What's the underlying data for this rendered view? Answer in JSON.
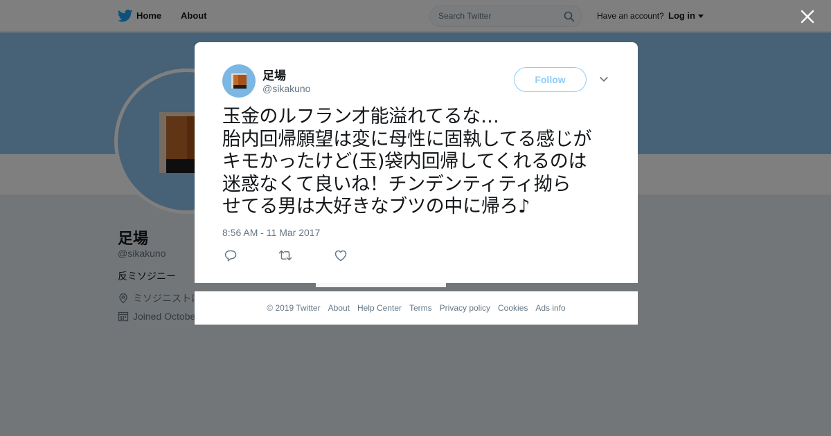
{
  "nav": {
    "home_label": "Home",
    "about_label": "About",
    "search_placeholder": "Search Twitter",
    "account_prompt": "Have an account?",
    "login_label": "Log in",
    "logo_icon": "twitter-bird-icon",
    "search_icon": "magnifier-icon",
    "caret_icon": "caret-down-icon"
  },
  "profile": {
    "name": "足場",
    "handle": "@sikakuno",
    "bio": "反ミソジニー",
    "location": "ミソジニストに",
    "joined": "Joined October",
    "location_icon": "location-pin-icon",
    "calendar_icon": "calendar-icon",
    "banner_color": "#8ec3ec"
  },
  "tweet": {
    "author_name": "足場",
    "author_handle": "@sikakuno",
    "follow_label": "Follow",
    "text_lines": [
      "玉金のルフラン才能溢れてるな…",
      "胎内回帰願望は変に母性に固執してる感じが",
      "キモかったけど(玉)袋内回帰してくれるのは",
      "迷惑なくて良いね！チンデンティティ拗ら",
      "せてる男は大好きなブツの中に帰ろ♪"
    ],
    "timestamp": "8:56 AM - 11 Mar 2017",
    "actions": [
      "reply-icon",
      "retweet-icon",
      "like-icon"
    ],
    "more_icon": "chevron-down-icon"
  },
  "footer": {
    "links": [
      "© 2019 Twitter",
      "About",
      "Help Center",
      "Terms",
      "Privacy policy",
      "Cookies",
      "Ads info"
    ]
  },
  "close_icon": "close-icon",
  "colors": {
    "accent": "#1da1f2",
    "follow_border": "#8ecdf8",
    "secondary_text": "#657786"
  }
}
